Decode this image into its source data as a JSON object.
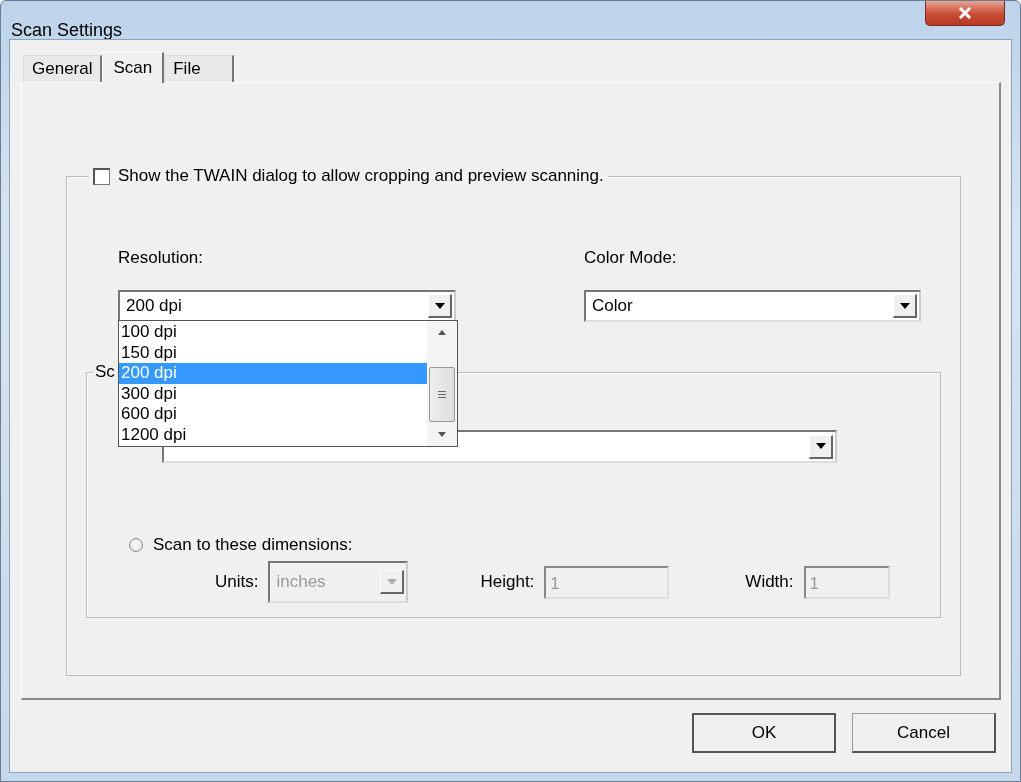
{
  "window": {
    "title": "Scan Settings"
  },
  "tabs": [
    {
      "label": "General",
      "selected": false
    },
    {
      "label": "Scan",
      "selected": true
    },
    {
      "label": "File",
      "selected": false
    }
  ],
  "twain": {
    "label": "Show the TWAIN dialog to allow cropping and preview scanning.",
    "checked": false
  },
  "resolution": {
    "label": "Resolution:",
    "value": "200 dpi",
    "expanded": true,
    "options": [
      {
        "label": "100 dpi",
        "selected": false
      },
      {
        "label": "150 dpi",
        "selected": false
      },
      {
        "label": "200 dpi",
        "selected": true
      },
      {
        "label": "300 dpi",
        "selected": false
      },
      {
        "label": "600 dpi",
        "selected": false
      },
      {
        "label": "1200 dpi",
        "selected": false
      }
    ]
  },
  "color_mode": {
    "label": "Color Mode:",
    "value": "Color"
  },
  "scan_group": {
    "legend": "Sc",
    "dimensions": {
      "label": "Scan to these dimensions:",
      "selected": false
    },
    "units": {
      "label": "Units:",
      "value": "inches",
      "disabled": true
    },
    "height": {
      "label": "Height:",
      "value": "1",
      "disabled": true
    },
    "width": {
      "label": "Width:",
      "value": "1",
      "disabled": true
    }
  },
  "buttons": [
    {
      "label": "OK",
      "default": true
    },
    {
      "label": "Cancel",
      "default": false
    }
  ]
}
